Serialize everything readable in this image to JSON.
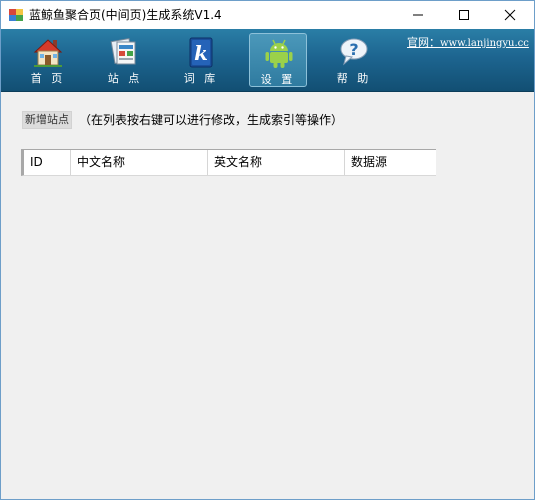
{
  "window": {
    "title": "蓝鲸鱼聚合页(中间页)生成系统V1.4"
  },
  "toolbar": {
    "items": [
      {
        "label": "首 页",
        "icon": "house-icon"
      },
      {
        "label": "站 点",
        "icon": "sites-icon"
      },
      {
        "label": "词 库",
        "icon": "dictionary-k-icon"
      },
      {
        "label": "设 置",
        "icon": "android-icon",
        "active": true
      },
      {
        "label": "帮 助",
        "icon": "help-icon"
      }
    ],
    "website_label": "官网：",
    "website_url": "www.lanjingyu.cc"
  },
  "content": {
    "add_site_label": "新增站点",
    "hint": "（在列表按右键可以进行修改，生成索引等操作）"
  },
  "table": {
    "columns": [
      "ID",
      "中文名称",
      "英文名称",
      "数据源"
    ]
  },
  "colors": {
    "toolbar_top": "#2a7ea6",
    "toolbar_bottom": "#124f73",
    "background": "#f0f0f0"
  }
}
